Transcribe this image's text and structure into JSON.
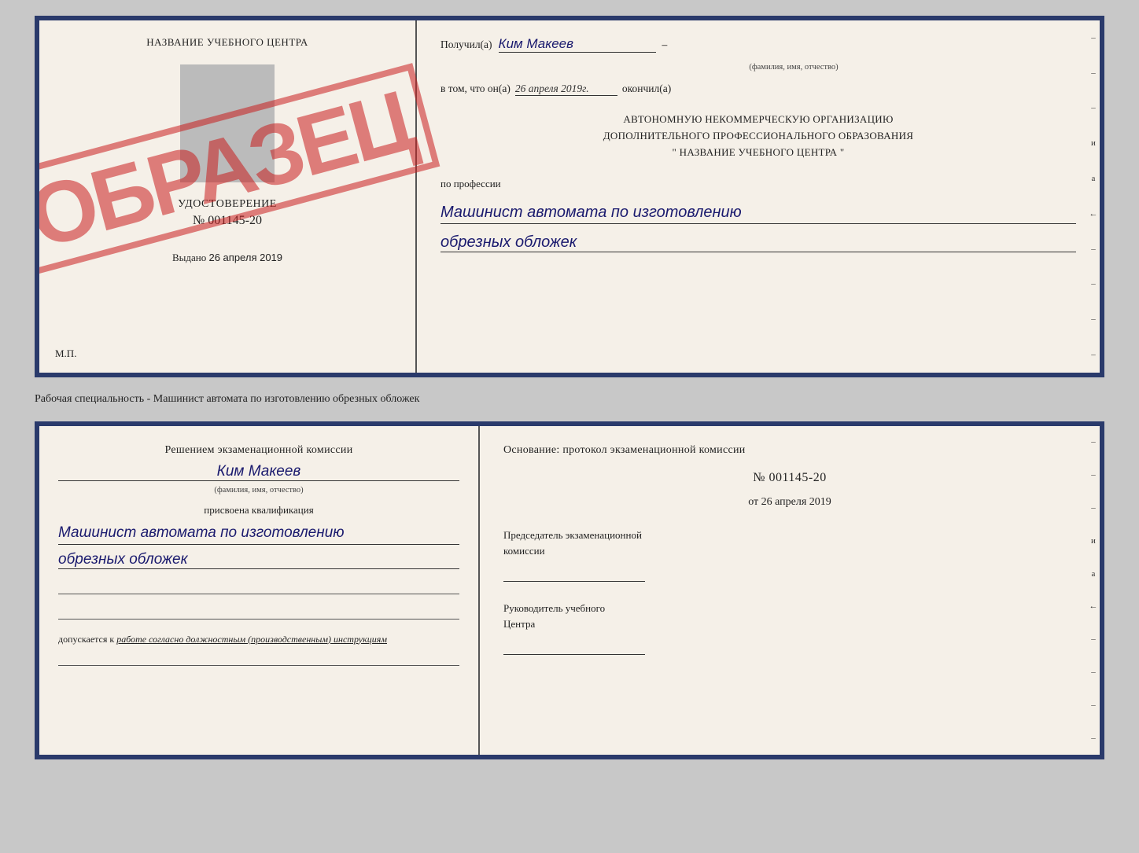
{
  "top_doc": {
    "left": {
      "school_name": "НАЗВАНИЕ УЧЕБНОГО ЦЕНТРА",
      "cert_label": "УДОСТОВЕРЕНИЕ",
      "cert_number": "№ 001145-20",
      "vydano_label": "Выдано",
      "vydano_date": "26 апреля 2019",
      "mp_label": "М.П.",
      "stamp_text": "ОБРАЗЕЦ"
    },
    "right": {
      "received_label": "Получил(а)",
      "received_name": "Ким Макеев",
      "fio_label": "(фамилия, имя, отчество)",
      "vtom_label": "в том, что он(а)",
      "vtom_date": "26 апреля 2019г.",
      "okончил_label": "окончил(а)",
      "org_line1": "АВТОНОМНУЮ НЕКОММЕРЧЕСКУЮ ОРГАНИЗАЦИЮ",
      "org_line2": "ДОПОЛНИТЕЛЬНОГО ПРОФЕССИОНАЛЬНОГО ОБРАЗОВАНИЯ",
      "org_line3": "\"   НАЗВАНИЕ УЧЕБНОГО ЦЕНТРА   \"",
      "po_professii": "по профессии",
      "profession_line1": "Машинист автомата по изготовлению",
      "profession_line2": "обрезных обложек"
    }
  },
  "separator": {
    "text": "Рабочая специальность - Машинист автомата по изготовлению обрезных обложек"
  },
  "bottom_doc": {
    "left": {
      "resheniem_line1": "Решением экзаменационной комиссии",
      "person_name": "Ким Макеев",
      "fio_label": "(фамилия, имя, отчество)",
      "prisvoena": "присвоена квалификация",
      "profession_line1": "Машинист автомата по изготовлению",
      "profession_line2": "обрезных обложек",
      "dopuskaetsya_prefix": "допускается к",
      "dopuskaetsya_text": "работе согласно должностным (производственным) инструкциям"
    },
    "right": {
      "osnovanie_label": "Основание: протокол экзаменационной комиссии",
      "protocol_number": "№ 001145-20",
      "ot_label": "от",
      "ot_date": "26 апреля 2019",
      "predsedatel_line1": "Председатель экзаменационной",
      "predsedatel_line2": "комиссии",
      "rukovoditel_line1": "Руководитель учебного",
      "rukovoditel_line2": "Центра"
    }
  },
  "side_dashes": [
    "–",
    "–",
    "–",
    "и",
    "а",
    "←",
    "–",
    "–",
    "–",
    "–"
  ],
  "colors": {
    "border": "#2a3a6b",
    "stamp": "rgba(200,30,30,0.55)",
    "bg": "#f5f0e8",
    "name_ink": "#1a1a6e",
    "body_text": "#222"
  }
}
